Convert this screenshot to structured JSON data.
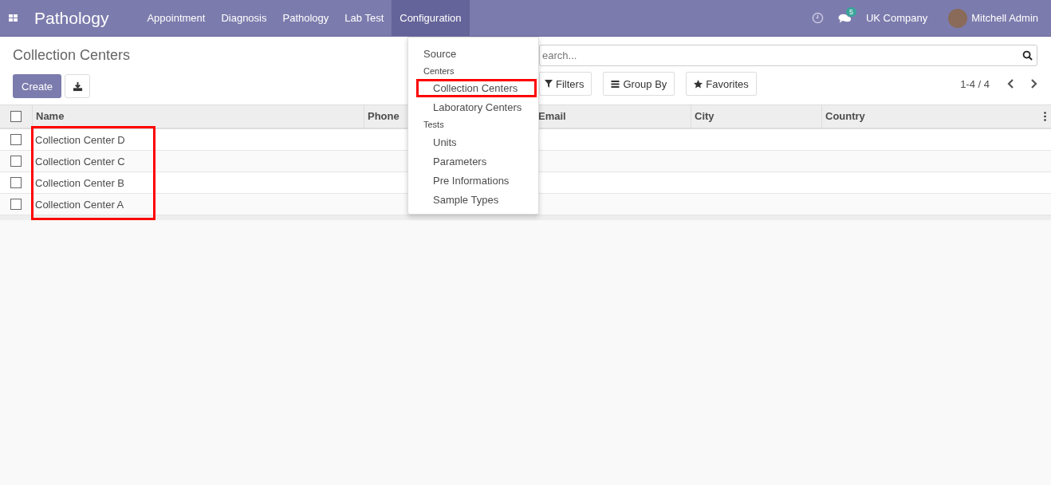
{
  "navbar": {
    "app_name": "Pathology",
    "menus": [
      {
        "label": "Appointment",
        "selected": false
      },
      {
        "label": "Diagnosis",
        "selected": false
      },
      {
        "label": "Pathology",
        "selected": false
      },
      {
        "label": "Lab Test",
        "selected": false
      },
      {
        "label": "Configuration",
        "selected": true
      }
    ],
    "chat_count": "5",
    "company": "UK Company",
    "user": "Mitchell Admin"
  },
  "page": {
    "title": "Collection Centers",
    "create_label": "Create"
  },
  "search": {
    "placeholder": "earch..."
  },
  "filters": [
    {
      "kind": "filter",
      "label": "Filters"
    },
    {
      "kind": "group",
      "label": "Group By"
    },
    {
      "kind": "favorite",
      "label": "Favorites"
    }
  ],
  "pager": "1-4 / 4",
  "table": {
    "all_checked": false,
    "columns": [
      "Name",
      "Phone",
      "Email",
      "City",
      "Country"
    ],
    "rows_highlighted": true,
    "rows": [
      {
        "name": "Collection Center D",
        "checked": false
      },
      {
        "name": "Collection Center C",
        "checked": false
      },
      {
        "name": "Collection Center B",
        "checked": false
      },
      {
        "name": "Collection Center A",
        "checked": false
      }
    ]
  },
  "dropdown": [
    {
      "kind": "item",
      "label": "Source",
      "highlighted": false
    },
    {
      "kind": "header",
      "label": "Centers"
    },
    {
      "kind": "subitem",
      "label": "Collection Centers",
      "highlighted": true
    },
    {
      "kind": "subitem",
      "label": "Laboratory Centers",
      "highlighted": false
    },
    {
      "kind": "header",
      "label": "Tests"
    },
    {
      "kind": "subitem",
      "label": "Units",
      "highlighted": false
    },
    {
      "kind": "subitem",
      "label": "Parameters",
      "highlighted": false
    },
    {
      "kind": "subitem",
      "label": "Pre Informations",
      "highlighted": false
    },
    {
      "kind": "subitem",
      "label": "Sample Types",
      "highlighted": false
    }
  ]
}
